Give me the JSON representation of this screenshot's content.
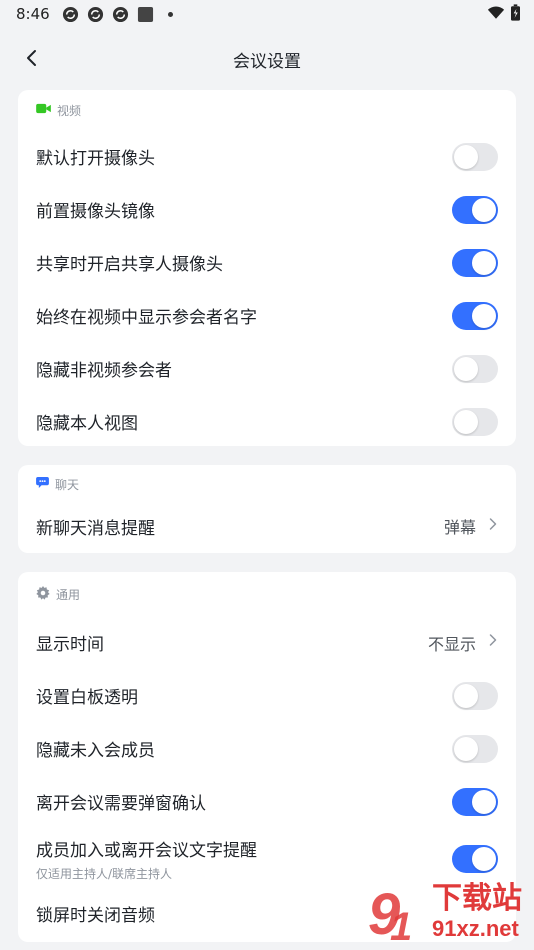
{
  "status_bar": {
    "time": "8:46",
    "icons": [
      "sync-icon",
      "sync-icon",
      "sync-icon",
      "square-icon",
      "dot-icon"
    ],
    "right_icons": [
      "wifi-icon",
      "battery-icon"
    ]
  },
  "nav": {
    "title": "会议设置",
    "back_icon": "chevron-left-icon"
  },
  "video": {
    "header": "视频",
    "header_icon": "video-camera-icon",
    "header_icon_color": "#34c724",
    "rows": [
      {
        "label": "默认打开摄像头",
        "on": false
      },
      {
        "label": "前置摄像头镜像",
        "on": true
      },
      {
        "label": "共享时开启共享人摄像头",
        "on": true
      },
      {
        "label": "始终在视频中显示参会者名字",
        "on": true
      },
      {
        "label": "隐藏非视频参会者",
        "on": false
      },
      {
        "label": "隐藏本人视图",
        "on": false
      }
    ]
  },
  "chat": {
    "header": "聊天",
    "header_icon": "chat-bubble-icon",
    "header_icon_color": "#3370ff",
    "rows": [
      {
        "label": "新聊天消息提醒",
        "value": "弹幕"
      }
    ]
  },
  "general": {
    "header": "通用",
    "header_icon": "gear-icon",
    "rows": [
      {
        "label": "显示时间",
        "value": "不显示"
      },
      {
        "label": "设置白板透明",
        "on": false
      },
      {
        "label": "隐藏未入会成员",
        "on": false
      },
      {
        "label": "离开会议需要弹窗确认",
        "on": true
      },
      {
        "label": "成员加入或离开会议文字提醒",
        "sub": "仅适用主持人/联席主持人",
        "on": true
      },
      {
        "label": "锁屏时关闭音频"
      }
    ]
  },
  "colors": {
    "accent": "#3370ff",
    "toggle_off": "#e6e7ea",
    "background": "#f2f3f5"
  },
  "watermark": {
    "text": "下载站",
    "url_text": "91xz.net"
  }
}
